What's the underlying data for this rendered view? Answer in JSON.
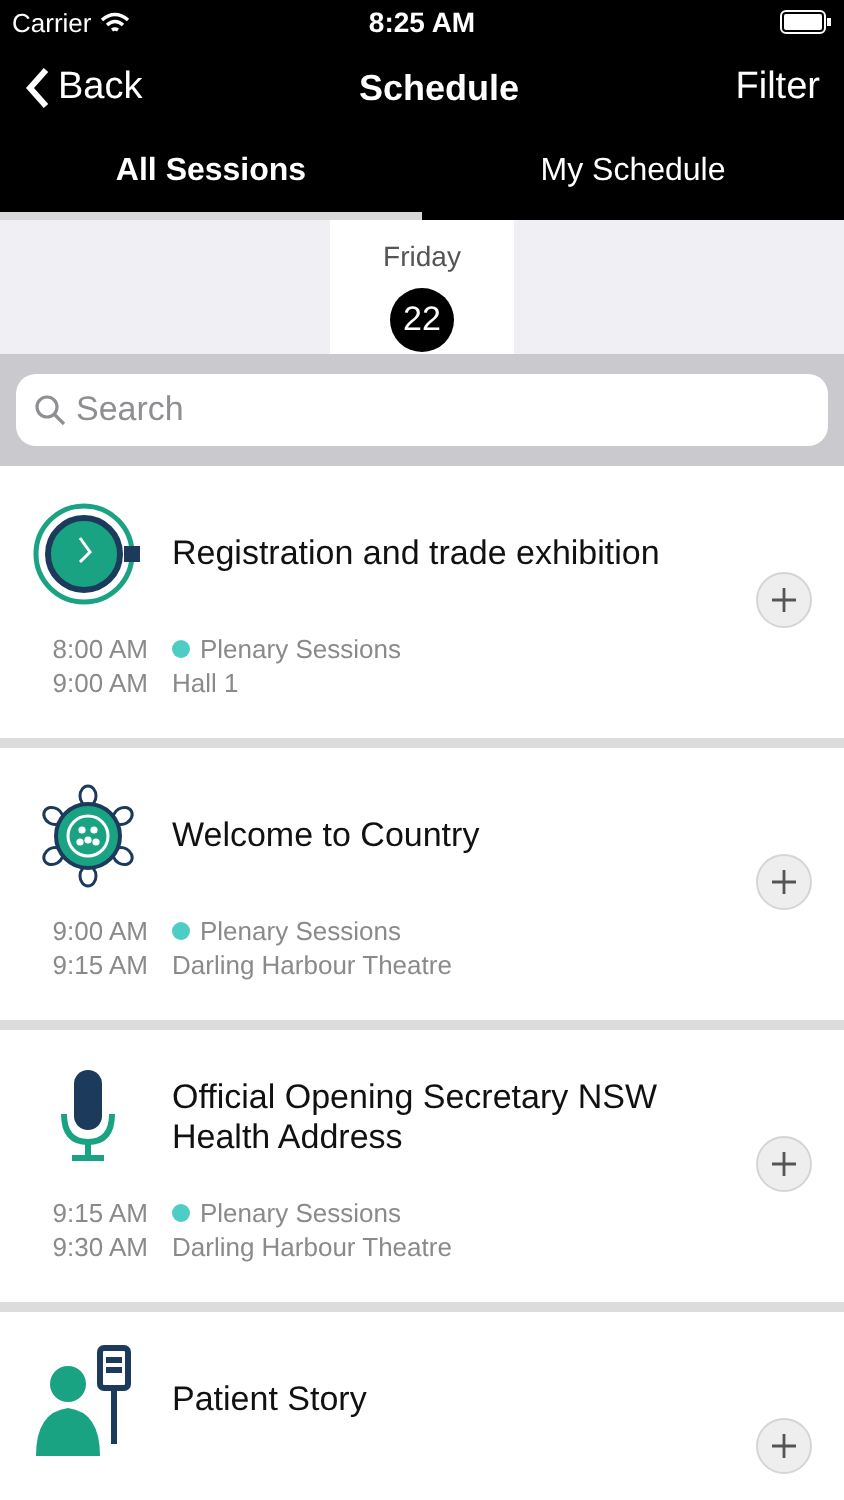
{
  "status_bar": {
    "carrier": "Carrier",
    "time": "8:25 AM"
  },
  "nav": {
    "back": "Back",
    "title": "Schedule",
    "action": "Filter"
  },
  "tabs": [
    {
      "label": "All Sessions",
      "selected": true
    },
    {
      "label": "My Schedule",
      "selected": false
    }
  ],
  "days": [
    {
      "weekday": "Friday",
      "date": "22",
      "selected": true
    }
  ],
  "search": {
    "placeholder": "Search"
  },
  "sessions": [
    {
      "title": "Registration and trade exhibition",
      "start": "8:00 AM",
      "end": "9:00 AM",
      "category": "Plenary Sessions",
      "color": "#4ecdc4",
      "location": "Hall 1"
    },
    {
      "title": "Welcome to Country",
      "start": "9:00 AM",
      "end": "9:15 AM",
      "category": "Plenary Sessions",
      "color": "#4ecdc4",
      "location": "Darling Harbour Theatre"
    },
    {
      "title": "Official Opening Secretary NSW Health Address",
      "start": "9:15 AM",
      "end": "9:30 AM",
      "category": "Plenary Sessions",
      "color": "#4ecdc4",
      "location": "Darling Harbour Theatre"
    },
    {
      "title": "Patient Story"
    }
  ]
}
